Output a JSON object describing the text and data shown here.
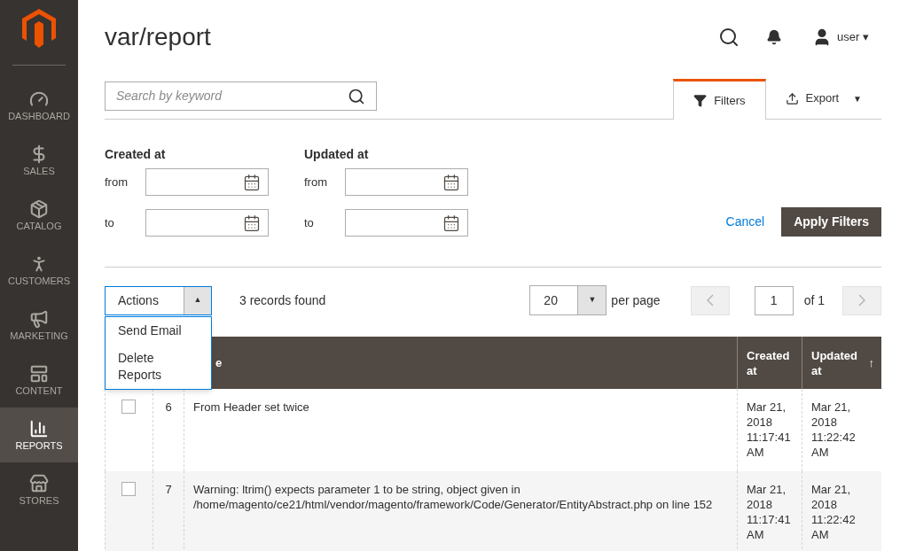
{
  "sidebar": {
    "items": [
      {
        "label": "DASHBOARD",
        "selected": false
      },
      {
        "label": "SALES",
        "selected": false
      },
      {
        "label": "CATALOG",
        "selected": false
      },
      {
        "label": "CUSTOMERS",
        "selected": false
      },
      {
        "label": "MARKETING",
        "selected": false
      },
      {
        "label": "CONTENT",
        "selected": false
      },
      {
        "label": "REPORTS",
        "selected": true
      },
      {
        "label": "STORES",
        "selected": false
      }
    ]
  },
  "header": {
    "title": "var/report",
    "user": "user",
    "user_caret": "▾"
  },
  "search": {
    "placeholder": "Search by keyword"
  },
  "tabs": [
    {
      "label": "Filters",
      "kind": "filter",
      "selected": true
    },
    {
      "label": "Export",
      "kind": "export",
      "caret": "▼",
      "selected": false
    }
  ],
  "filters": [
    {
      "label": "Created at",
      "from": "from",
      "to": "to"
    },
    {
      "label": "Updated at",
      "from": "from",
      "to": "to"
    }
  ],
  "filter_buttons": {
    "cancel": "Cancel",
    "apply": "Apply Filters"
  },
  "actions": {
    "label": "Actions",
    "caret": "▲",
    "expanded": true,
    "options": [
      "Send Email",
      "Delete Reports"
    ]
  },
  "records": "3 records found",
  "pager": {
    "per_page": "20",
    "caret": "▼",
    "per_page_label": "per page",
    "page": "1",
    "of": "of 1"
  },
  "table": {
    "columns": [
      {
        "label": "e"
      },
      {
        "label": "Created at"
      },
      {
        "label": "Updated at",
        "sort": "↑"
      }
    ],
    "rows": [
      {
        "checked": false,
        "id": "6",
        "message": "From Header set twice",
        "created": "Mar 21, 2018 11:17:41 AM",
        "updated": "Mar 21, 2018 11:22:42 AM"
      },
      {
        "checked": false,
        "id": "7",
        "message": "Warning: ltrim() expects parameter 1 to be string, object given in /home/magento/ce21/html/vendor/magento/framework/Code/Generator/EntityAbstract.php on line 152",
        "created": "Mar 21, 2018 11:17:41 AM",
        "updated": "Mar 21, 2018 11:22:42 AM"
      }
    ]
  }
}
